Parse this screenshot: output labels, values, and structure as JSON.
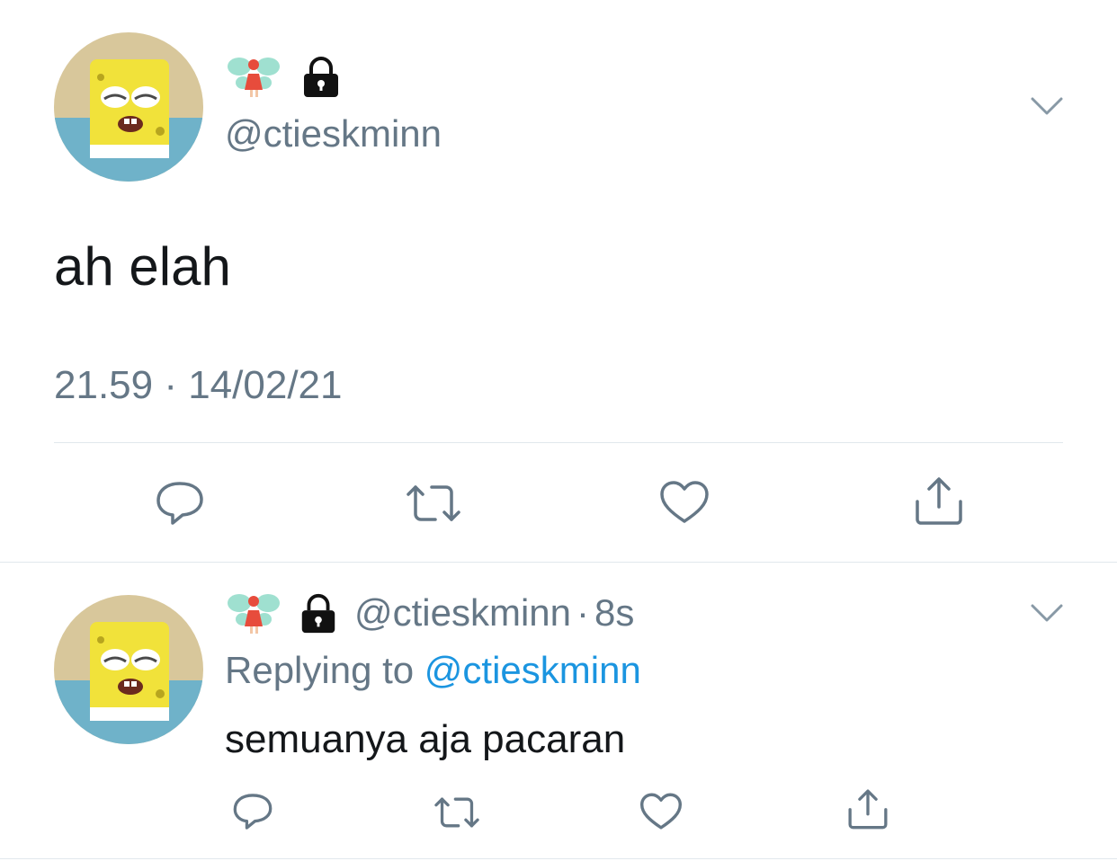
{
  "main_tweet": {
    "handle": "@ctieskminn",
    "text": "ah elah",
    "timestamp": "21.59 · 14/02/21",
    "avatar_icon": "spongebob-avatar-icon",
    "badges": [
      "fairy-emoji-icon",
      "lock-icon"
    ],
    "actions": [
      "reply-icon",
      "retweet-icon",
      "like-icon",
      "share-icon"
    ]
  },
  "reply_tweet": {
    "handle": "@ctieskminn",
    "separator": "·",
    "age": "8s",
    "replying_prefix": "Replying to",
    "replying_to": "@ctieskminn",
    "text": "semuanya aja pacaran",
    "avatar_icon": "spongebob-avatar-icon",
    "badges": [
      "fairy-emoji-icon",
      "lock-icon"
    ],
    "actions": [
      "reply-icon",
      "retweet-icon",
      "like-icon",
      "share-icon"
    ]
  },
  "colors": {
    "text": "#14171a",
    "secondary": "#657786",
    "link": "#1b95e0",
    "icon": "#657786",
    "divider": "#e1e8ed"
  }
}
